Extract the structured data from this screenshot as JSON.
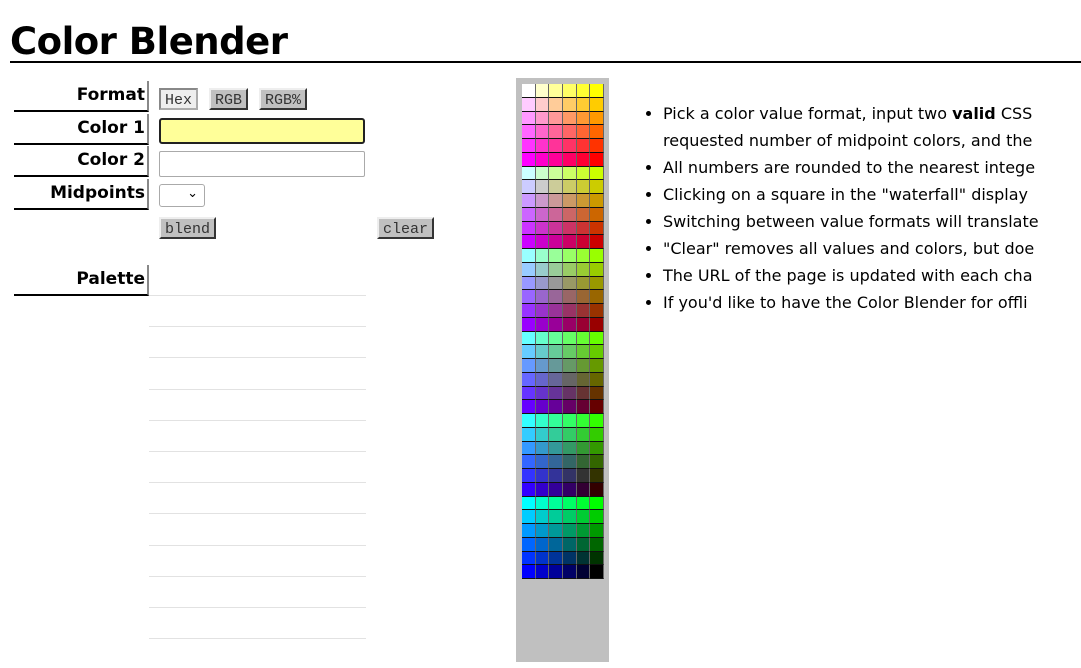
{
  "title": "Color Blender",
  "labels": {
    "format": "Format",
    "color1": "Color 1",
    "color2": "Color 2",
    "midpoints": "Midpoints",
    "palette": "Palette"
  },
  "format_buttons": [
    {
      "label": "Hex",
      "selected": true
    },
    {
      "label": "RGB",
      "selected": false
    },
    {
      "label": "RGB%",
      "selected": false
    }
  ],
  "inputs": {
    "color1": "",
    "color2": "",
    "midpoints": ""
  },
  "colors": {
    "color1_bg": "#ffff99",
    "panel": "#c0c0c0"
  },
  "actions": {
    "blend": "blend",
    "clear": "clear"
  },
  "waterfall": {
    "levels": [
      "FF",
      "CC",
      "99",
      "66",
      "33",
      "00"
    ],
    "order": "red by group, green by row, blue by column"
  },
  "notes": [
    {
      "pre": "Pick a color value format, input two ",
      "bold": "valid",
      "post": " CSS",
      "line2": "requested number of midpoint colors, and the"
    },
    {
      "text": "All numbers are rounded to the nearest intege"
    },
    {
      "text": "Clicking on a square in the \"waterfall\" display"
    },
    {
      "text": "Switching between value formats will translate"
    },
    {
      "text": "\"Clear\" removes all values and colors, but doe"
    },
    {
      "text": "The URL of the page is updated with each cha"
    },
    {
      "text": "If you'd like to have the Color Blender for offli"
    }
  ]
}
